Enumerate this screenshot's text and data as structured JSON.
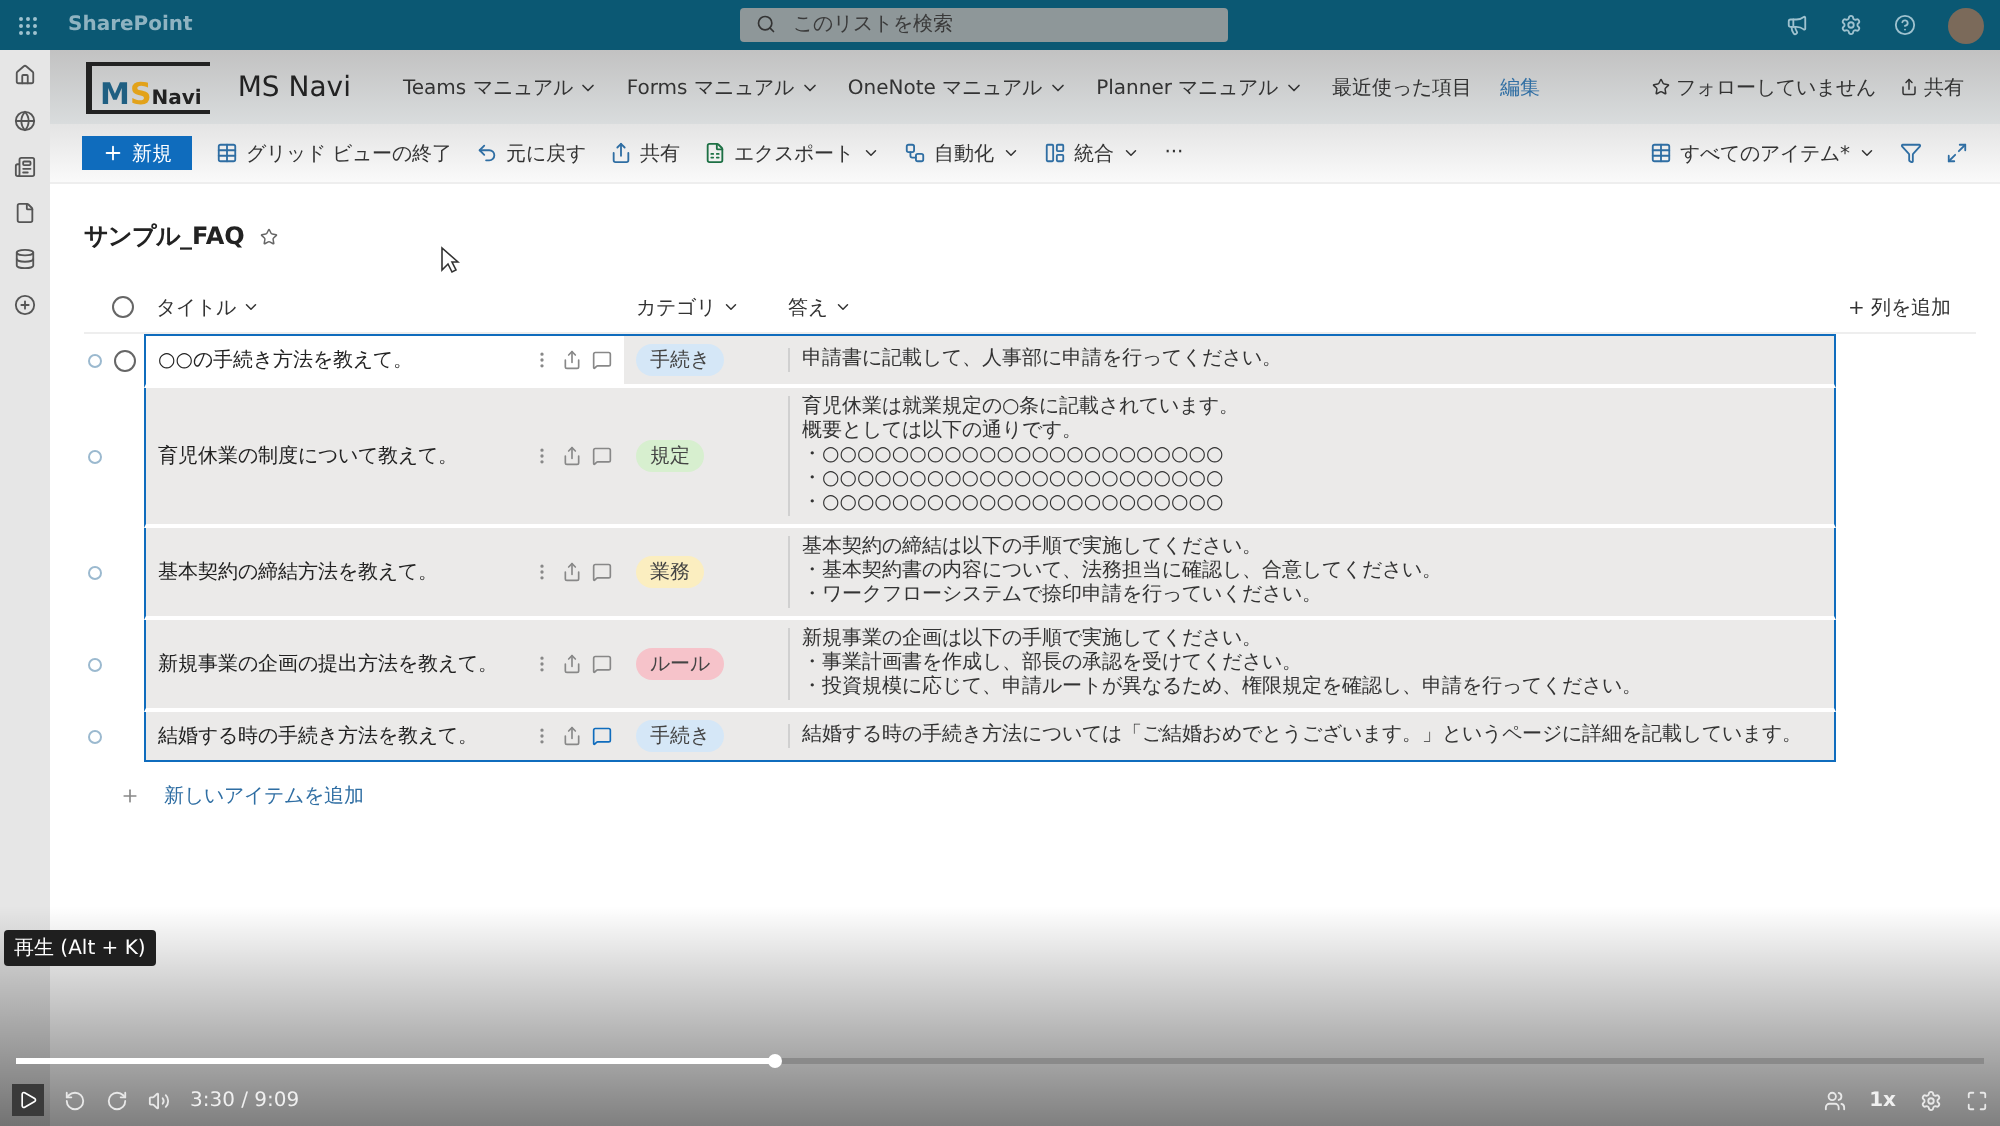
{
  "suite_bar": {
    "app_name": "SharePoint",
    "search": {
      "placeholder": "このリストを検索"
    }
  },
  "site_header": {
    "logo": [
      "M",
      "S",
      "Navi"
    ],
    "title": "MS Navi",
    "nav": [
      {
        "label": "Teams マニュアル",
        "dropdown": true
      },
      {
        "label": "Forms マニュアル",
        "dropdown": true
      },
      {
        "label": "OneNote マニュアル",
        "dropdown": true
      },
      {
        "label": "Planner マニュアル",
        "dropdown": true
      },
      {
        "label": "最近使った項目",
        "dropdown": false
      }
    ],
    "edit_link": "編集",
    "follow": "フォローしていません",
    "share": "共有"
  },
  "command_bar": {
    "new_button": "新規",
    "commands": [
      {
        "kind": "grid",
        "label": "グリッド ビューの終了",
        "dropdown": false
      },
      {
        "kind": "undo",
        "label": "元に戻す",
        "dropdown": false
      },
      {
        "kind": "share",
        "label": "共有",
        "dropdown": false
      },
      {
        "kind": "excel",
        "label": "エクスポート",
        "dropdown": true
      },
      {
        "kind": "automate",
        "label": "自動化",
        "dropdown": true
      },
      {
        "kind": "integrate",
        "label": "統合",
        "dropdown": true
      }
    ],
    "more": "···",
    "view": "すべてのアイテム*"
  },
  "list": {
    "title": "サンプル_FAQ",
    "all_checked": false,
    "columns": [
      "タイトル",
      "カテゴリ",
      "答え"
    ],
    "add_column": "+ 列を追加",
    "rows": [
      {
        "checked": false,
        "selected": true,
        "title": "○○の手続き方法を教えて。",
        "category": {
          "label": "手続き",
          "color": "#d5e7f7"
        },
        "answer": [
          "申請書に記載して、人事部に申請を行ってください。"
        ],
        "has_comments": false
      },
      {
        "checked": false,
        "selected": false,
        "title": "育児休業の制度について教えて。",
        "category": {
          "label": "規定",
          "color": "#d7efcf"
        },
        "answer": [
          "育児休業は就業規定の○条に記載されています。",
          "概要としては以下の通りです。",
          "・○○○○○○○○○○○○○○○○○○○○○○○",
          "・○○○○○○○○○○○○○○○○○○○○○○○",
          "・○○○○○○○○○○○○○○○○○○○○○○○"
        ],
        "has_comments": false
      },
      {
        "checked": false,
        "selected": false,
        "title": "基本契約の締結方法を教えて。",
        "category": {
          "label": "業務",
          "color": "#fbeec0"
        },
        "answer": [
          "基本契約の締結は以下の手順で実施してください。",
          "・基本契約書の内容について、法務担当に確認し、合意してください。",
          "・ワークフローシステムで捺印申請を行っていください。"
        ],
        "has_comments": false
      },
      {
        "checked": false,
        "selected": false,
        "title": "新規事業の企画の提出方法を教えて。",
        "category": {
          "label": "ルール",
          "color": "#f6c3ca"
        },
        "answer": [
          "新規事業の企画は以下の手順で実施してください。",
          "・事業計画書を作成し、部長の承認を受けてください。",
          "・投資規模に応じて、申請ルートが異なるため、権限規定を確認し、申請を行ってください。"
        ],
        "has_comments": false
      },
      {
        "checked": false,
        "selected": false,
        "title": "結婚する時の手続き方法を教えて。",
        "category": {
          "label": "手続き",
          "color": "#d5e7f7"
        },
        "answer": [
          "結婚する時の手続き方法については「ご結婚おめでとうございます。」というページに詳細を記載しています。"
        ],
        "has_comments": true
      }
    ],
    "add_item": "新しいアイテムを追加"
  },
  "player": {
    "tooltip": "再生 (Alt + K)",
    "progress": {
      "level": 0.385
    },
    "time": "3:30 / 9:09",
    "speed": "1x"
  }
}
